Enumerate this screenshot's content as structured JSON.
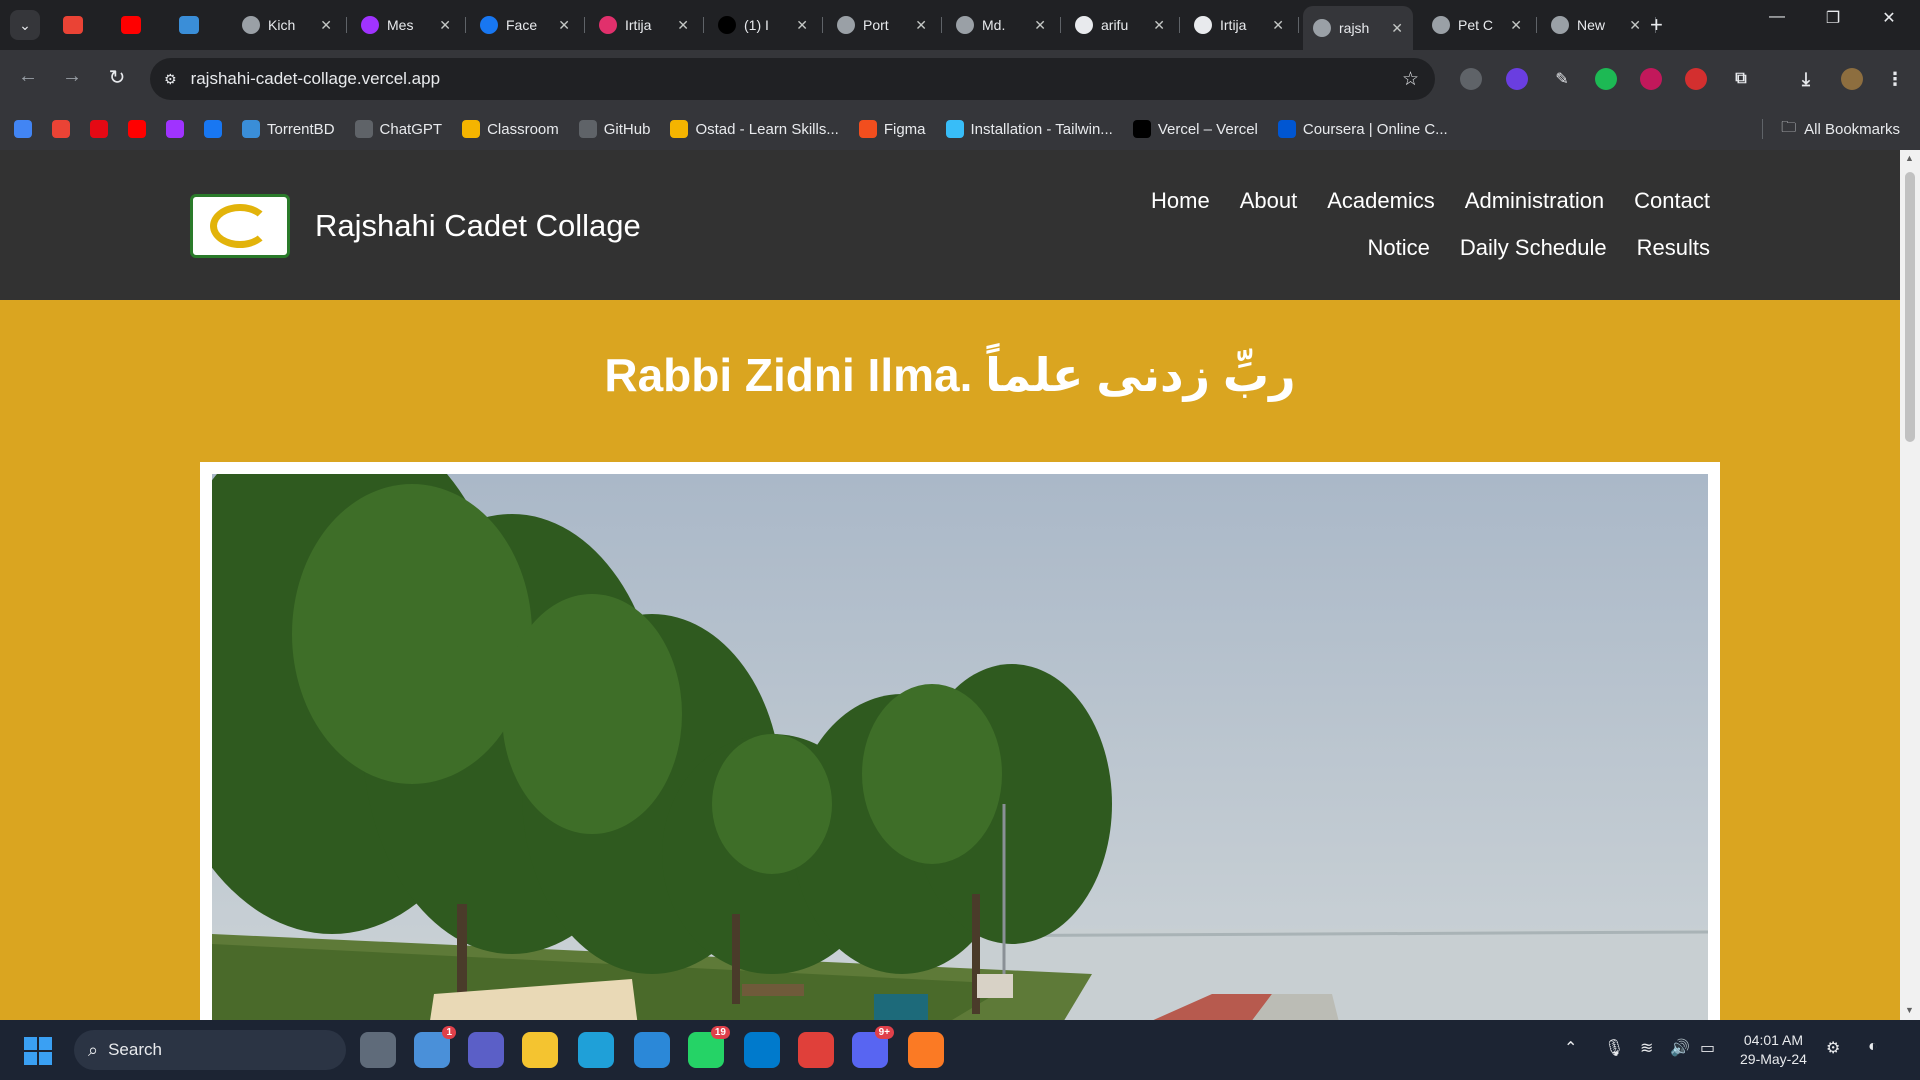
{
  "browser": {
    "tabs": [
      {
        "title": "",
        "icon": "gmail-icon",
        "color": "#ea4335",
        "pinned": true
      },
      {
        "title": "",
        "icon": "youtube-icon",
        "color": "#ff0000",
        "pinned": true
      },
      {
        "title": "",
        "icon": "torrentbd-icon",
        "color": "#3a8ed8",
        "pinned": true
      },
      {
        "title": "Kich",
        "icon": "globe-icon",
        "color": "#9aa0a6"
      },
      {
        "title": "Mes",
        "icon": "messenger-icon",
        "color": "#a033ff"
      },
      {
        "title": "Face",
        "icon": "facebook-icon",
        "color": "#1877f2"
      },
      {
        "title": "Irtija",
        "icon": "instagram-icon",
        "color": "#e1306c"
      },
      {
        "title": "(1) I",
        "icon": "x-icon",
        "color": "#000000"
      },
      {
        "title": "Port",
        "icon": "globe-icon",
        "color": "#9aa0a6"
      },
      {
        "title": "Md.",
        "icon": "globe-icon",
        "color": "#9aa0a6"
      },
      {
        "title": "arifu",
        "icon": "github-icon",
        "color": "#e8eaed"
      },
      {
        "title": "Irtija",
        "icon": "github-icon",
        "color": "#e8eaed"
      },
      {
        "title": "rajsh",
        "icon": "globe-icon",
        "color": "#9aa0a6",
        "active": true
      },
      {
        "title": "Pet C",
        "icon": "globe-icon",
        "color": "#9aa0a6"
      },
      {
        "title": "New",
        "icon": "chrome-icon",
        "color": "#9aa0a6"
      }
    ],
    "url": "rajshahi-cadet-collage.vercel.app",
    "bookmarks": [
      {
        "label": "",
        "icon": "bookmark-app-icon",
        "color": "#4285f4"
      },
      {
        "label": "",
        "icon": "gmail-icon",
        "color": "#ea4335"
      },
      {
        "label": "",
        "icon": "netflix-icon",
        "color": "#e50914"
      },
      {
        "label": "",
        "icon": "youtube-icon",
        "color": "#ff0000"
      },
      {
        "label": "",
        "icon": "messenger-icon",
        "color": "#a033ff"
      },
      {
        "label": "",
        "icon": "facebook-icon",
        "color": "#1877f2"
      },
      {
        "label": "TorrentBD",
        "icon": "torrentbd-icon",
        "color": "#3a8ed8"
      },
      {
        "label": "ChatGPT",
        "icon": "chatgpt-icon",
        "color": "#5f6368"
      },
      {
        "label": "Classroom",
        "icon": "classroom-icon",
        "color": "#f4b400"
      },
      {
        "label": "GitHub",
        "icon": "github-icon",
        "color": "#5f6368"
      },
      {
        "label": "Ostad - Learn Skills...",
        "icon": "ostad-icon",
        "color": "#f4b400"
      },
      {
        "label": "Figma",
        "icon": "figma-icon",
        "color": "#f24e1e"
      },
      {
        "label": "Installation - Tailwin...",
        "icon": "tailwind-icon",
        "color": "#38bdf8"
      },
      {
        "label": "Vercel – Vercel",
        "icon": "vercel-icon",
        "color": "#000000"
      },
      {
        "label": "Coursera | Online C...",
        "icon": "coursera-icon",
        "color": "#0056d2"
      }
    ],
    "all_bookmarks": "All Bookmarks"
  },
  "site": {
    "name": "Rajshahi Cadet Collage",
    "nav_row1": [
      "Home",
      "About",
      "Academics",
      "Administration",
      "Contact"
    ],
    "nav_row2": [
      "Notice",
      "Daily Schedule",
      "Results"
    ],
    "motto": "Rabbi Zidni Ilma. ربِّ زدنی علماً",
    "colors": {
      "header": "#323232",
      "background": "#daa520",
      "text": "#ffffff"
    }
  },
  "taskbar": {
    "search_label": "Search",
    "apps": [
      {
        "icon": "task-view-icon",
        "color": "#5f6b7a",
        "badge": ""
      },
      {
        "icon": "weather-icon",
        "color": "#4a90d9",
        "badge": "1"
      },
      {
        "icon": "teams-icon",
        "color": "#5b5fc7",
        "badge": ""
      },
      {
        "icon": "file-explorer-icon",
        "color": "#f4c430",
        "badge": ""
      },
      {
        "icon": "edge-icon",
        "color": "#1fa0d8",
        "badge": ""
      },
      {
        "icon": "mail-icon",
        "color": "#2b88d8",
        "badge": ""
      },
      {
        "icon": "whatsapp-icon",
        "color": "#25d366",
        "badge": "19"
      },
      {
        "icon": "vscode-icon",
        "color": "#007acc",
        "badge": ""
      },
      {
        "icon": "chrome-icon",
        "color": "#e0403a",
        "badge": ""
      },
      {
        "icon": "discord-icon",
        "color": "#5865f2",
        "badge": "9+"
      },
      {
        "icon": "xampp-icon",
        "color": "#fb7a24",
        "badge": ""
      }
    ],
    "time": "04:01 AM",
    "date": "29-May-24"
  }
}
